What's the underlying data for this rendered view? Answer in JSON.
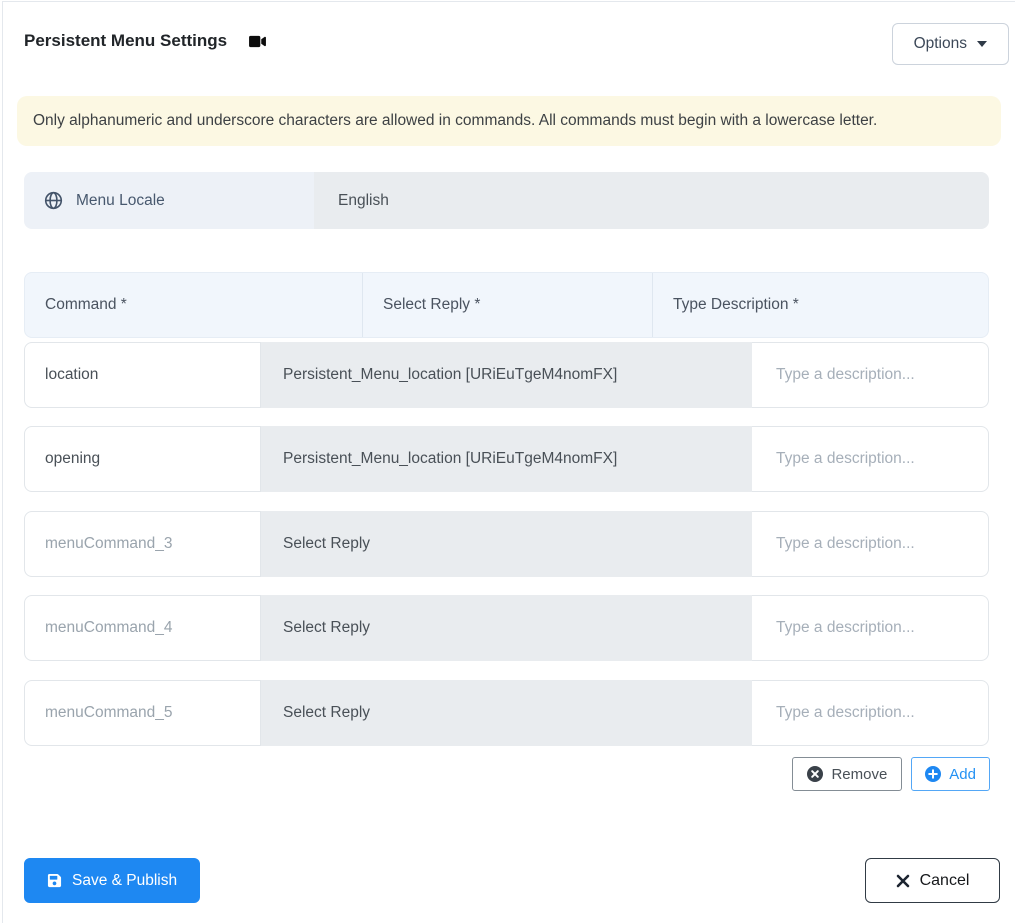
{
  "header": {
    "title": "Persistent Menu Settings",
    "options_label": "Options"
  },
  "banner": {
    "text": "Only alphanumeric and underscore characters are allowed in commands. All commands must begin with a lowercase letter."
  },
  "locale": {
    "label": "Menu Locale",
    "value": "English"
  },
  "table": {
    "headers": {
      "command": "Command *",
      "reply": "Select Reply *",
      "description": "Type Description *"
    },
    "description_placeholder": "Type a description...",
    "rows": [
      {
        "command": "location",
        "command_is_placeholder": false,
        "reply": "Persistent_Menu_location [URiEuTgeM4nomFX]",
        "reply_is_set": true
      },
      {
        "command": "opening",
        "command_is_placeholder": false,
        "reply": "Persistent_Menu_location [URiEuTgeM4nomFX]",
        "reply_is_set": true
      },
      {
        "command": "menuCommand_3",
        "command_is_placeholder": true,
        "reply": "Select Reply",
        "reply_is_set": false
      },
      {
        "command": "menuCommand_4",
        "command_is_placeholder": true,
        "reply": "Select Reply",
        "reply_is_set": false
      },
      {
        "command": "menuCommand_5",
        "command_is_placeholder": true,
        "reply": "Select Reply",
        "reply_is_set": false
      }
    ]
  },
  "row_actions": {
    "remove_label": "Remove",
    "add_label": "Add"
  },
  "footer": {
    "save_label": "Save & Publish",
    "cancel_label": "Cancel"
  },
  "icons": {
    "title_icon": "video-camera",
    "locale_icon": "globe",
    "options_caret": "caret-down",
    "remove_icon": "circle-x",
    "add_icon": "circle-plus",
    "save_icon": "floppy-disk",
    "cancel_icon": "x-mark"
  },
  "colors": {
    "primary_blue": "#1e88f2",
    "banner_bg": "#fcf8e3",
    "readonly_gray": "#e9ecef",
    "table_header_bg": "#f1f6fc",
    "locale_label_bg": "#edf1f7",
    "dark_text": "#495057",
    "placeholder_text": "#a6afb9"
  }
}
